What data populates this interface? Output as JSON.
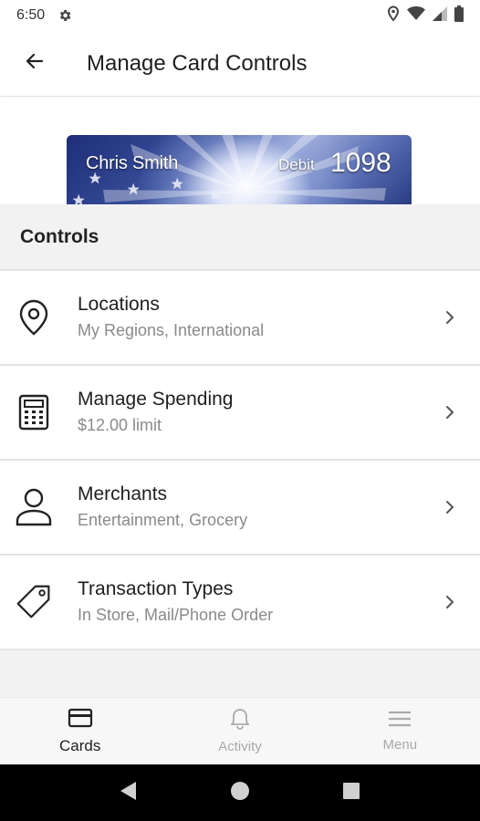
{
  "status_bar": {
    "time": "6:50",
    "icons": [
      "gear-icon",
      "location-icon",
      "wifi-icon",
      "signal-icon",
      "battery-icon"
    ]
  },
  "app_bar": {
    "title": "Manage Card Controls",
    "back_icon": "arrow-back-icon"
  },
  "card": {
    "holder_name": "Chris Smith",
    "type": "Debit",
    "last4": "1098"
  },
  "section": {
    "title": "Controls"
  },
  "controls": [
    {
      "icon": "location-pin-icon",
      "title": "Locations",
      "subtitle": "My Regions, International"
    },
    {
      "icon": "calculator-icon",
      "title": "Manage Spending",
      "subtitle": "$12.00 limit"
    },
    {
      "icon": "person-icon",
      "title": "Merchants",
      "subtitle": "Entertainment, Grocery"
    },
    {
      "icon": "tag-icon",
      "title": "Transaction Types",
      "subtitle": "In Store, Mail/Phone Order"
    }
  ],
  "bottom_nav": {
    "items": [
      {
        "label": "Cards",
        "icon": "card-icon",
        "active": true
      },
      {
        "label": "Activity",
        "icon": "bell-icon",
        "active": false
      },
      {
        "label": "Menu",
        "icon": "menu-icon",
        "active": false
      }
    ]
  },
  "system_nav": [
    "back-triangle-icon",
    "home-circle-icon",
    "recents-square-icon"
  ],
  "colors": {
    "background": "#ffffff",
    "section_bg": "#f2f2f2",
    "subtitle": "#8a8a8a",
    "inactive_nav": "#a9a9a9",
    "card_blue": "#2a3c8a"
  }
}
